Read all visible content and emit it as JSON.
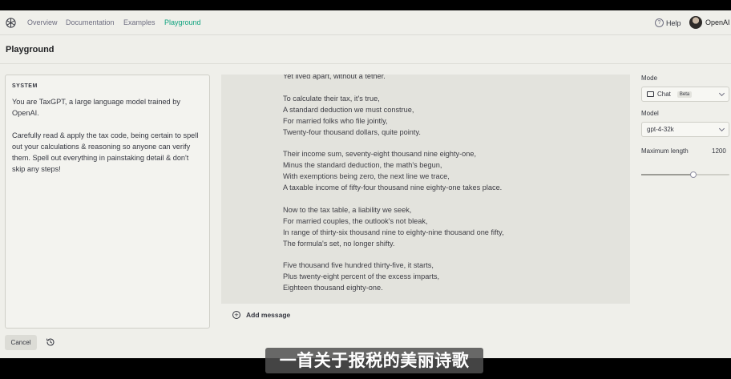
{
  "nav": {
    "links": [
      "Overview",
      "Documentation",
      "Examples",
      "Playground"
    ],
    "help": "Help",
    "account": "OpenAI"
  },
  "page": {
    "title": "Playground"
  },
  "system": {
    "label": "SYSTEM",
    "text": "You are TaxGPT, a large language model trained by OpenAI.\n\nCarefully read & apply the tax code, being certain to spell out your calculations & reasoning so anyone can verify them. Spell out everything in painstaking detail & don't skip any steps!"
  },
  "conversation": {
    "lines": [
      "Yet lived apart, without a tether.",
      "",
      "To calculate their tax, it's true,",
      "A standard deduction we must construe,",
      "For married folks who file jointly,",
      "Twenty-four thousand dollars, quite pointy.",
      "",
      "Their income sum, seventy-eight thousand nine eighty-one,",
      "Minus the standard deduction, the math's begun,",
      "With exemptions being zero, the next line we trace,",
      "A taxable income of fifty-four thousand nine eighty-one takes place.",
      "",
      "Now to the tax table, a liability we seek,",
      "For married couples, the outlook's not bleak,",
      "In range of thirty-six thousand nine to eighty-nine thousand one fifty,",
      "The formula's set, no longer shifty.",
      "",
      "Five thousand five hundred thirty-five, it starts,",
      "Plus twenty-eight percent of the excess imparts,",
      "Eighteen thousand eighty-one."
    ],
    "add_message": "Add message"
  },
  "actions": {
    "cancel": "Cancel"
  },
  "settings": {
    "mode_label": "Mode",
    "mode_value": "Chat",
    "mode_badge": "Beta",
    "model_label": "Model",
    "model_value": "gpt-4-32k",
    "max_length_label": "Maximum length",
    "max_length_value": "1200",
    "max_length_fraction": 0.59
  },
  "subtitle": "一首关于报税的美丽诗歌",
  "colors": {
    "accent": "#10a37f",
    "background": "#efefea",
    "text": "#353740"
  }
}
